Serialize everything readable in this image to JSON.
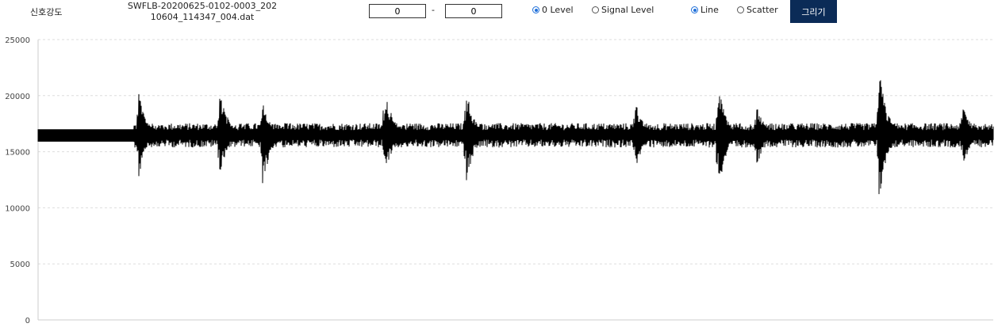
{
  "header": {
    "title": "신호강도",
    "file_name": "SWFLB-20200625-0102-0003_20210604_114347_004.dat"
  },
  "range": {
    "from": "0",
    "to": "0",
    "separator": "-"
  },
  "level_mode": {
    "options": [
      {
        "label": "0 Level",
        "checked": true
      },
      {
        "label": "Signal Level",
        "checked": false
      }
    ]
  },
  "plot_mode": {
    "options": [
      {
        "label": "Line",
        "checked": true
      },
      {
        "label": "Scatter",
        "checked": false
      }
    ]
  },
  "draw_button": {
    "label": "그리기",
    "color": "#0b2b57"
  },
  "accent_color": "#1f6fd9",
  "chart_data": {
    "type": "line",
    "title": "",
    "xlabel": "",
    "ylabel": "",
    "ylim": [
      0,
      25000
    ],
    "yticks": [
      0,
      5000,
      10000,
      15000,
      20000,
      25000
    ],
    "grid": true,
    "line_color": "#000000",
    "baseline": 16500,
    "noise_amplitude": 700,
    "quiet_segment": {
      "x_start": 0.0,
      "x_end": 0.1,
      "min": 15900,
      "max": 17000
    },
    "x_range": [
      0,
      1
    ],
    "bursts": [
      {
        "x": 0.105,
        "max": 20600,
        "min": 12300
      },
      {
        "x": 0.19,
        "max": 21000,
        "min": 12400
      },
      {
        "x": 0.235,
        "max": 19500,
        "min": 11600
      },
      {
        "x": 0.363,
        "max": 21000,
        "min": 12600
      },
      {
        "x": 0.448,
        "max": 20900,
        "min": 11700
      },
      {
        "x": 0.625,
        "max": 19800,
        "min": 13000
      },
      {
        "x": 0.712,
        "max": 21400,
        "min": 11000
      },
      {
        "x": 0.752,
        "max": 19600,
        "min": 13400
      },
      {
        "x": 0.88,
        "max": 23200,
        "min": 10000
      },
      {
        "x": 0.968,
        "max": 19700,
        "min": 13300
      }
    ]
  }
}
